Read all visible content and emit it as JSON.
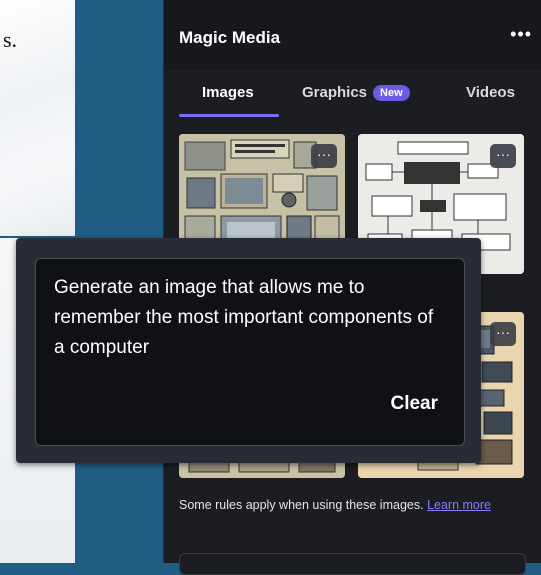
{
  "background": {
    "doc_fragment": "s."
  },
  "panel": {
    "title": "Magic Media",
    "more_label": "•••",
    "tabs": [
      {
        "label": "Images",
        "active": true
      },
      {
        "label": "Graphics",
        "badge": "New"
      },
      {
        "label": "Videos"
      }
    ],
    "thumbnail_more_label": "···",
    "rules_text": "Some rules apply when using these images.",
    "learn_more": "Learn more"
  },
  "prompt": {
    "text": "Generate an image that allows me to remember the most important components of a computer",
    "clear_label": "Clear"
  },
  "colors": {
    "accent": "#7b6cf6",
    "new_badge": "#6b5ae6",
    "panel_bg": "#1b1d23",
    "page_bg": "#1f5d84"
  }
}
